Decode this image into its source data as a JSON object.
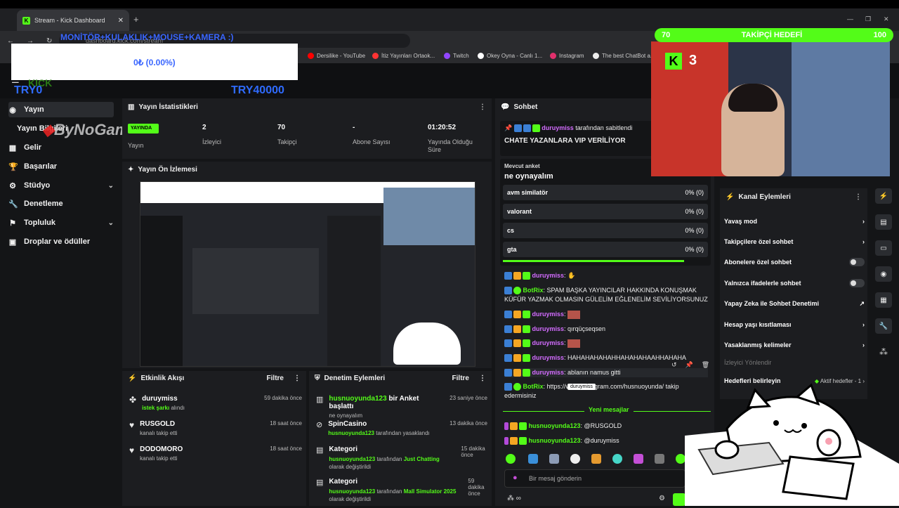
{
  "browser": {
    "tab_title": "Stream - Kick Dashboard",
    "url": "dashboard.kick.com/stream",
    "bookmarks": [
      "Dersilike - YouTube",
      "İtiz Yayınları Ortaok...",
      "Twitch",
      "Okey Oyna - Canlı 1...",
      "Instagram",
      "The best ChatBot a..."
    ]
  },
  "goal_overlay": {
    "title": "MONİTÖR+KULAKLIK+MOUSE+KAMERA :)",
    "value": "0₺ (0.00%)",
    "min": "TRY0",
    "max": "TRY40000"
  },
  "sidebar": {
    "logo_text": "ByNoGame",
    "items": [
      {
        "label": "Yayın",
        "icon": "play-icon",
        "active": true
      },
      {
        "label": "Yayın Bilgileri",
        "icon": "",
        "active": false
      },
      {
        "label": "Gelir",
        "icon": "dollar-icon",
        "active": false
      },
      {
        "label": "Başarılar",
        "icon": "trophy-icon",
        "active": false
      },
      {
        "label": "Stüdyo",
        "icon": "studio-icon",
        "active": false
      },
      {
        "label": "Denetleme",
        "icon": "wrench-icon",
        "active": false
      },
      {
        "label": "Topluluk",
        "icon": "community-icon",
        "active": false
      },
      {
        "label": "Droplar ve ödüller",
        "icon": "gift-icon",
        "active": false
      }
    ]
  },
  "stats": {
    "header": "Yayın İstatistikleri",
    "live_badge": "YAYINDA",
    "live_label": "Yayın",
    "items": [
      {
        "value": "2",
        "label": "İzleyici"
      },
      {
        "value": "70",
        "label": "Takipçi"
      },
      {
        "value": "-",
        "label": "Abone Sayısı"
      },
      {
        "value": "01:20:52",
        "label": "Yayında Olduğu Süre"
      }
    ]
  },
  "preview": {
    "header": "Yayın Ön İzlemesi"
  },
  "activity": {
    "header": "Etkinlik Akışı",
    "filter": "Filtre",
    "items": [
      {
        "name": "duruymiss",
        "highlight": "istek şarkı",
        "rest": "alındı",
        "time": "59 dakika önce"
      },
      {
        "name": "RUSGOLD",
        "highlight": "",
        "rest": "kanalı takip etti",
        "time": "18 saat önce"
      },
      {
        "name": "DODOMORO",
        "highlight": "",
        "rest": "kanalı takip etti",
        "time": "18 saat önce"
      }
    ]
  },
  "moderation": {
    "header": "Denetim Eylemleri",
    "filter": "Filtre",
    "items": [
      {
        "title_user": "husnuoyunda123",
        "title_rest": "bir Anket başlattı",
        "sub": "ne oynayalım",
        "time": "23 saniye önce"
      },
      {
        "title_user": "",
        "title_rest": "SpinCasino",
        "sub_user": "husnuoyunda123",
        "sub": "tarafından yasaklandı",
        "time": "13 dakika önce"
      },
      {
        "title_user": "",
        "title_rest": "Kategori",
        "sub_user": "husnuoyunda123",
        "sub": "tarafından",
        "sub_hl": "Just Chatting",
        "sub_end": "olarak değiştirildi",
        "time": "15 dakika önce"
      },
      {
        "title_user": "",
        "title_rest": "Kategori",
        "sub_user": "husnuoyunda123",
        "sub": "tarafından",
        "sub_hl": "Mall Simulator 2025",
        "sub_end": "olarak değiştirildi",
        "time": "59 dakika önce"
      }
    ]
  },
  "chat": {
    "header": "Sohbet",
    "pinned_by_user": "duruymiss",
    "pinned_by_rest": "tarafından sabitlendi",
    "pinned_text": "CHATE YAZANLARA VIP VERİLİYOR",
    "poll_label": "Mevcut anket",
    "poll_question": "ne oynayalım",
    "poll_options": [
      {
        "label": "avm similatör",
        "result": "0% (0)"
      },
      {
        "label": "valorant",
        "result": "0% (0)"
      },
      {
        "label": "cs",
        "result": "0% (0)"
      },
      {
        "label": "gta",
        "result": "0% (0)"
      }
    ],
    "messages": [
      {
        "user": "duruymiss",
        "text": ":",
        "emote": true,
        "kind": "p"
      },
      {
        "user": "BotRix",
        "text": ": SPAM BAŞKA YAYINCILAR HAKKINDA KONUŞMAK KÜFÜR YAZMAK OLMASIN GÜLELİM EĞLENELİM SEVİLİYORSUNUZ",
        "kind": "g"
      },
      {
        "user": "duruymiss",
        "text": ":",
        "emote": true,
        "kind": "p"
      },
      {
        "user": "duruymiss",
        "text": ": qırqüçseqsen",
        "kind": "p"
      },
      {
        "user": "duruymiss",
        "text": ":",
        "emote": true,
        "kind": "p"
      },
      {
        "user": "duruymiss",
        "text": ": HAHAHAHAHAHHAHAHAHAAHHAHAHA",
        "kind": "p"
      },
      {
        "user": "duruymiss",
        "text": ": ablanın namus gitti",
        "kind": "p"
      },
      {
        "user": "BotRix",
        "text": ": https://www.instagram.com/husnuoyunda/ takip edermisiniz",
        "kind": "g"
      }
    ],
    "tooltip": "duruymiss",
    "new_messages": "Yeni mesajlar",
    "new": [
      {
        "user": "husnuoyunda123",
        "text": ": @RUSGOLD"
      },
      {
        "user": "husnuoyunda123",
        "text": ": @duruymiss"
      }
    ],
    "input_placeholder": "Bir mesaj gönderin"
  },
  "channel_actions": {
    "header": "Kanal Eylemleri",
    "items": [
      {
        "label": "Yavaş mod",
        "control": "chevron"
      },
      {
        "label": "Takipçilere özel sohbet",
        "control": "chevron"
      },
      {
        "label": "Abonelere özel sohbet",
        "control": "toggle"
      },
      {
        "label": "Yalnızca ifadelerle sohbet",
        "control": "toggle"
      },
      {
        "label": "Yapay Zeka ile Sohbet Denetimi",
        "control": "external"
      },
      {
        "label": "Hesap yaşı kısıtlaması",
        "control": "chevron"
      },
      {
        "label": "Yasaklanmış kelimeler",
        "control": "chevron"
      }
    ],
    "redirect_label": "İzleyici Yönlendir",
    "goals_label": "Hedefleri belirleyin",
    "goals_status": "Aktif hedefler - 1"
  },
  "webcam": {
    "follower_goal_label": "TAKİPÇİ HEDEFİ",
    "goal_current": "70",
    "goal_target": "100",
    "progress": 0.7,
    "kick_count": "3"
  },
  "colors": {
    "kick_green": "#53fc18",
    "bg": "#141517",
    "panel": "#1c1d20"
  }
}
